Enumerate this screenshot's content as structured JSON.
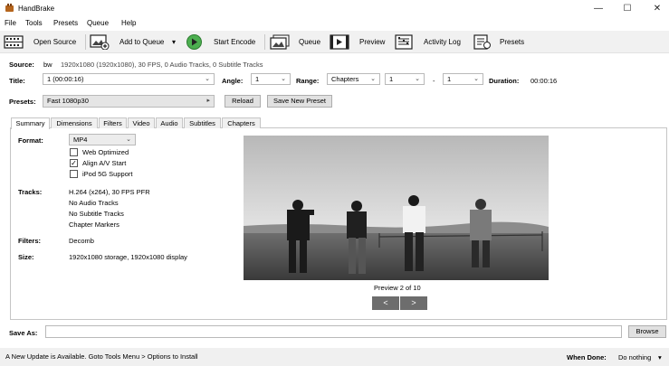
{
  "window": {
    "title": "HandBrake",
    "minimize_glyph": "—",
    "maximize_glyph": "☐",
    "close_glyph": "✕"
  },
  "menu": [
    "File",
    "Tools",
    "Presets",
    "Queue",
    "Help"
  ],
  "toolbar": {
    "open_source": "Open Source",
    "add_to_queue": "Add to Queue",
    "add_to_queue_arrow": "▾",
    "start_encode": "Start Encode",
    "queue": "Queue",
    "preview": "Preview",
    "activity_log": "Activity Log",
    "presets": "Presets"
  },
  "source": {
    "label": "Source:",
    "name": "bw",
    "details": "1920x1080 (1920x1080), 30 FPS, 0 Audio Tracks, 0 Subtitle Tracks"
  },
  "title_row": {
    "title_label": "Title:",
    "title_value": "1 (00:00:16)",
    "angle_label": "Angle:",
    "angle_value": "1",
    "range_label": "Range:",
    "range_type": "Chapters",
    "range_start": "1",
    "range_dash": "-",
    "range_end": "1",
    "duration_label": "Duration:",
    "duration_value": "00:00:16"
  },
  "presets_row": {
    "label": "Presets:",
    "value": "Fast 1080p30",
    "arrow": "▸",
    "reload": "Reload",
    "save_new": "Save New Preset"
  },
  "tabs": [
    "Summary",
    "Dimensions",
    "Filters",
    "Video",
    "Audio",
    "Subtitles",
    "Chapters"
  ],
  "summary": {
    "format_label": "Format:",
    "format_value": "MP4",
    "web_optimized": {
      "label": "Web Optimized",
      "checked": false
    },
    "align_av": {
      "label": "Align A/V Start",
      "checked": true
    },
    "ipod": {
      "label": "iPod 5G Support",
      "checked": false
    },
    "tracks_label": "Tracks:",
    "tracks": [
      "H.264 (x264), 30 FPS PFR",
      "No Audio Tracks",
      "No Subtitle Tracks",
      "Chapter Markers"
    ],
    "filters_label": "Filters:",
    "filters_value": "Decomb",
    "size_label": "Size:",
    "size_value": "1920x1080 storage, 1920x1080 display"
  },
  "preview": {
    "caption": "Preview 2 of 10",
    "prev": "<",
    "next": ">"
  },
  "save_as": {
    "label": "Save As:",
    "value": "",
    "browse": "Browse"
  },
  "status": {
    "message": "A New Update is Available. Goto Tools Menu > Options to Install",
    "when_done_label": "When Done:",
    "when_done_value": "Do nothing",
    "when_done_arrow": "▾"
  },
  "colors": {
    "start_green": "#4caf50",
    "toolbar_bg": "#f1f1f1",
    "nav_btn": "#6d6d6d"
  }
}
